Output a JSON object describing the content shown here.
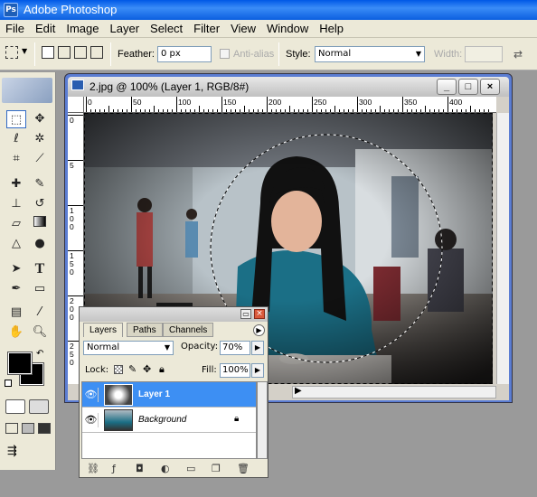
{
  "app": {
    "title": "Adobe Photoshop"
  },
  "menu": [
    "File",
    "Edit",
    "Image",
    "Layer",
    "Select",
    "Filter",
    "View",
    "Window",
    "Help"
  ],
  "options": {
    "feather_label": "Feather:",
    "feather_value": "0 px",
    "antialias_label": "Anti-alias",
    "style_label": "Style:",
    "style_value": "Normal",
    "width_label": "Width:"
  },
  "document": {
    "title": "2.jpg @ 100% (Layer 1, RGB/8#)",
    "ruler_h": [
      "0",
      "50",
      "100",
      "150",
      "200",
      "250",
      "300",
      "350",
      "400"
    ],
    "ruler_v": [
      "0",
      "5",
      "1\n0\n0",
      "1\n5\n0",
      "2\n0\n0",
      "2\n5\n0"
    ]
  },
  "layers_panel": {
    "tabs": [
      "Layers",
      "Paths",
      "Channels"
    ],
    "blend_mode": "Normal",
    "opacity_label": "Opacity:",
    "opacity_value": "70%",
    "lock_label": "Lock:",
    "fill_label": "Fill:",
    "fill_value": "100%",
    "layers": [
      {
        "name": "Layer 1",
        "selected": true
      },
      {
        "name": "Background",
        "selected": false,
        "locked": true
      }
    ]
  },
  "colors": {
    "accent": "#3d8ff3",
    "titlebar": "#0058e6"
  }
}
